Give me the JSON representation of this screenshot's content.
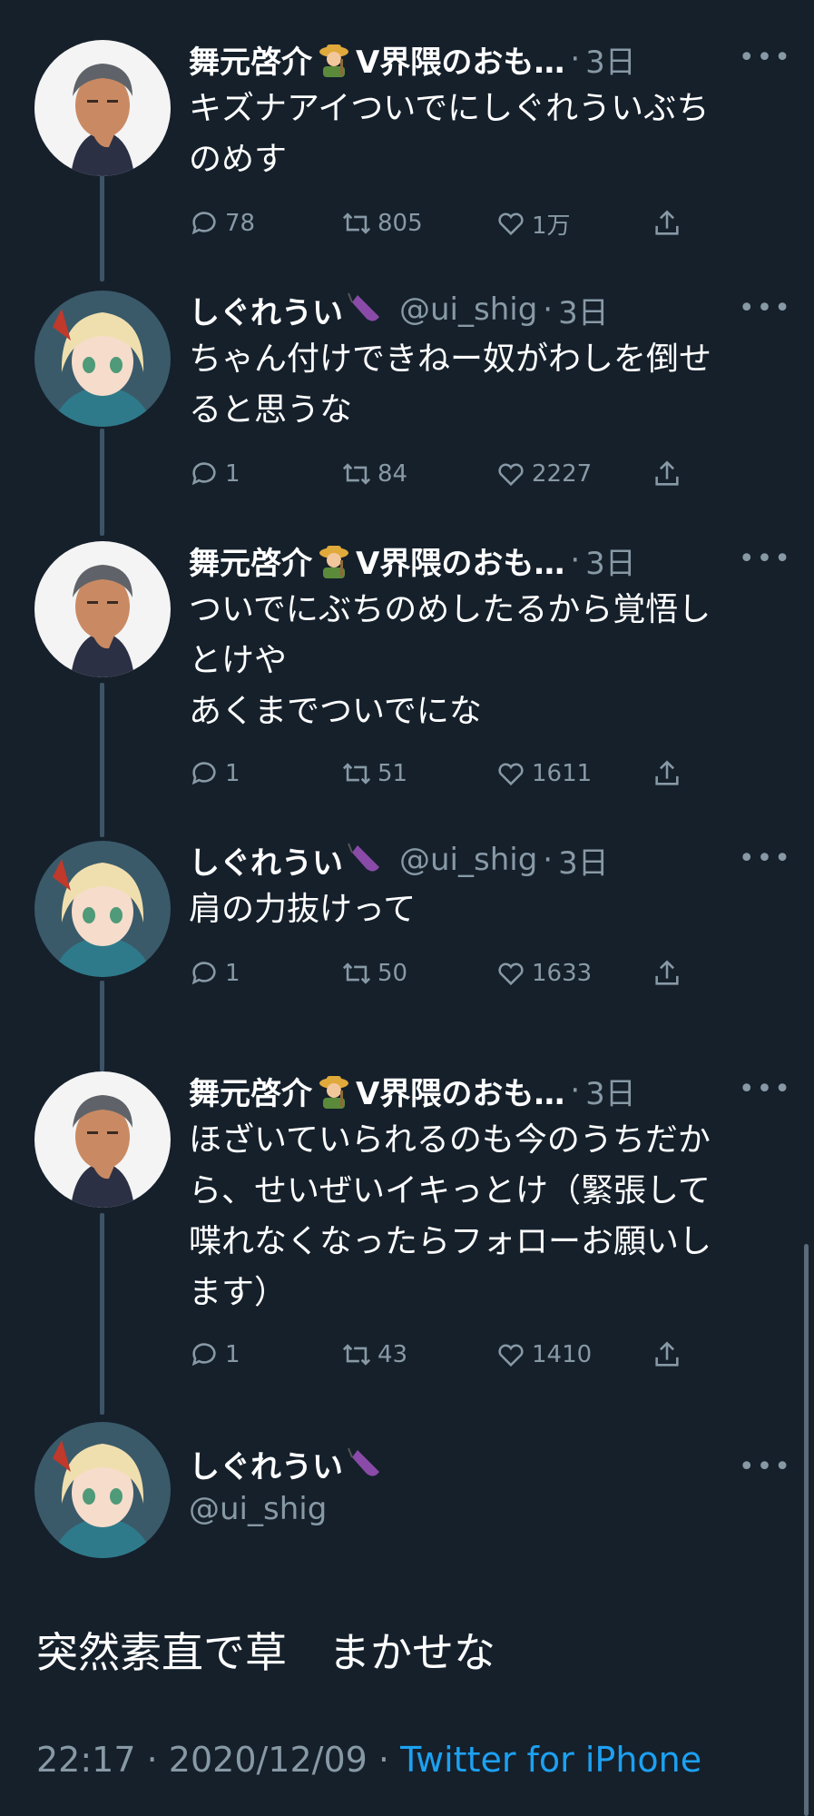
{
  "tweets": [
    {
      "name": "舞元啓介",
      "name_suffix": "V界隈のおも…",
      "handle": "",
      "time": "3日",
      "more": "•••",
      "text": "キズナアイついでにしぐれういぶち\nのめす",
      "reply": "78",
      "retweet": "805",
      "like": "1万",
      "avatar": "male"
    },
    {
      "name": "しぐれうい",
      "name_suffix": "",
      "handle": "@ui_shig",
      "time": "3日",
      "more": "•••",
      "text": "ちゃん付けできねー奴がわしを倒せ\nると思うな",
      "reply": "1",
      "retweet": "84",
      "like": "2227",
      "avatar": "female"
    },
    {
      "name": "舞元啓介",
      "name_suffix": "V界隈のおも…",
      "handle": "",
      "time": "3日",
      "more": "•••",
      "text": "ついでにぶちのめしたるから覚悟し\nとけや\nあくまでついでにな",
      "reply": "1",
      "retweet": "51",
      "like": "1611",
      "avatar": "male"
    },
    {
      "name": "しぐれうい",
      "name_suffix": "",
      "handle": "@ui_shig",
      "time": "3日",
      "more": "•••",
      "text": "肩の力抜けって",
      "reply": "1",
      "retweet": "50",
      "like": "1633",
      "avatar": "female"
    },
    {
      "name": "舞元啓介",
      "name_suffix": "V界隈のおも…",
      "handle": "",
      "time": "3日",
      "more": "•••",
      "text": "ほざいていられるのも今のうちだか\nら、せいぜいイキっとけ（緊張して\n喋れなくなったらフォローお願いし\nます）",
      "reply": "1",
      "retweet": "43",
      "like": "1410",
      "avatar": "male"
    }
  ],
  "focus": {
    "name": "しぐれうい",
    "handle": "@ui_shig",
    "more": "•••",
    "text": "突然素直で草　まかせな",
    "time": "22:17",
    "date": "2020/12/09",
    "separator": "·",
    "source": "Twitter for iPhone"
  },
  "colors": {
    "background": "#15202b",
    "muted": "#8899a6",
    "link": "#1da1f2",
    "thread": "#3d5466"
  },
  "icons": {
    "reply": "reply-icon",
    "retweet": "retweet-icon",
    "like": "heart-icon",
    "share": "share-icon",
    "more": "more-icon"
  }
}
